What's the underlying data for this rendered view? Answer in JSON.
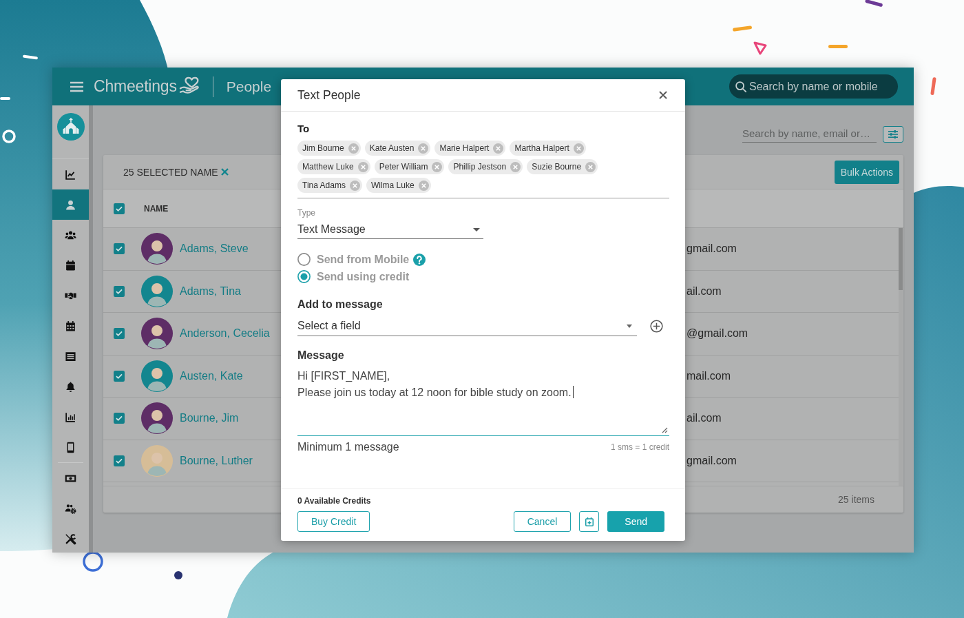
{
  "header": {
    "brand": "Chmeetings",
    "page_title": "People",
    "search": {
      "placeholder": "Search by name or mobile"
    }
  },
  "sidebar": {
    "items": [
      {
        "selected": false
      },
      {
        "selected": true
      },
      {
        "selected": false
      },
      {
        "selected": false
      },
      {
        "selected": false
      },
      {
        "selected": false
      },
      {
        "selected": false
      },
      {
        "selected": false
      },
      {
        "selected": false
      },
      {
        "selected": false
      },
      {
        "selected": false
      },
      {
        "selected": false
      },
      {
        "selected": false
      }
    ]
  },
  "toolbar": {
    "search": {
      "placeholder": "Search by name, email or…"
    }
  },
  "people_card": {
    "selection": "25 SELECTED NAME",
    "bulk_button": "Bulk Actions",
    "header_checked": true,
    "columns": [
      "NAME"
    ],
    "rows": [
      {
        "name": "Adams, Steve",
        "email": "gmail.com",
        "checked": true,
        "color": "#5e2d66"
      },
      {
        "name": "Adams, Tina",
        "email": "ail.com",
        "checked": true,
        "color": "#13868f"
      },
      {
        "name": "Anderson, Cecelia",
        "email": "@gmail.com",
        "checked": true,
        "color": "#5e2d66"
      },
      {
        "name": "Austen, Kate",
        "email": "mail.com",
        "checked": true,
        "color": "#13868f"
      },
      {
        "name": "Bourne, Jim",
        "email": "ail.com",
        "checked": true,
        "color": "#5e2d66"
      },
      {
        "name": "Bourne, Luther",
        "email": "gmail.com",
        "checked": true,
        "color": "#d6bd97"
      }
    ],
    "footer": "25 items"
  },
  "dialog": {
    "title": "Text People",
    "to_label": "To",
    "recipients": [
      "Jim Bourne",
      "Kate Austen",
      "Marie Halpert",
      "Martha Halpert",
      "Matthew Luke",
      "Peter William",
      "Phillip Jestson",
      "Suzie Bourne",
      "Tina Adams",
      "Wilma Luke"
    ],
    "type": {
      "label": "Type",
      "value": "Text Message"
    },
    "send_options": [
      {
        "label": "Send from Mobile",
        "selected": false,
        "help": true
      },
      {
        "label": "Send using credit",
        "selected": true,
        "help": false
      }
    ],
    "add_label": "Add to message",
    "field_select": {
      "placeholder": "Select a field"
    },
    "message": {
      "label": "Message",
      "value": "Hi [FIRST_NAME],\nPlease join us today at 12 noon for bible study on zoom.",
      "focused": true
    },
    "hint": "Minimum 1 message",
    "rate": "1 sms = 1 credit",
    "credits": "0 Available Credits",
    "buttons_left": [
      {
        "label": "Buy Credit",
        "kind": "outline"
      }
    ],
    "buttons_right": [
      {
        "label": "Cancel",
        "kind": "outline"
      },
      {
        "kind": "schedule"
      },
      {
        "label": "Send",
        "kind": "primary"
      }
    ]
  }
}
